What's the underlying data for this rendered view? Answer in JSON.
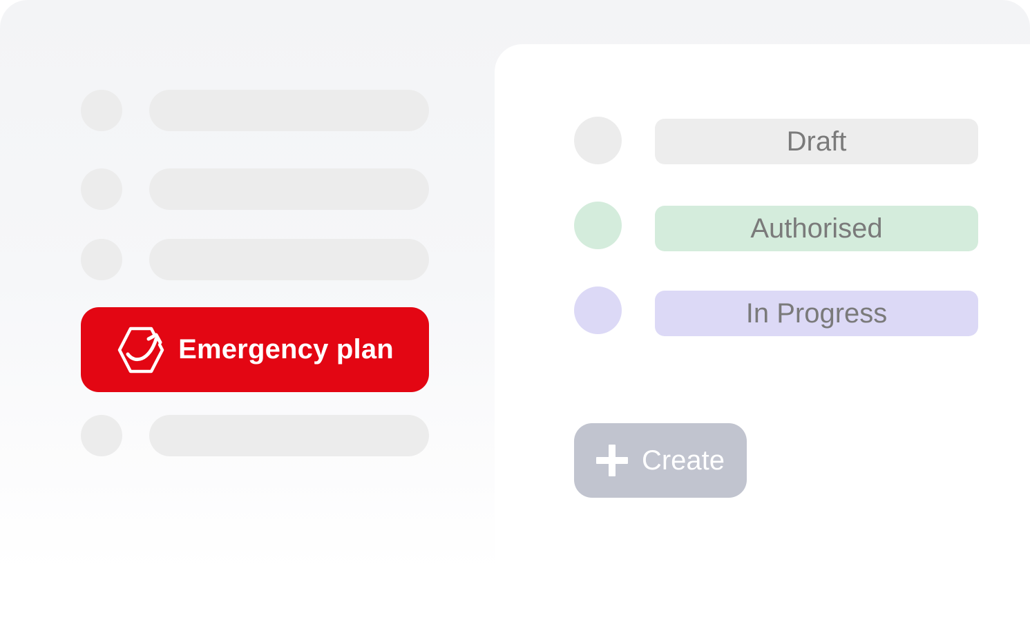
{
  "sidebar": {
    "emergency_button": {
      "label": "Emergency plan",
      "icon": "emergency-plan-icon",
      "color": "#e30613"
    },
    "placeholder_color": "#ececec"
  },
  "status_list": {
    "items": [
      {
        "label": "Draft",
        "dot_color": "#ececec",
        "pill_color": "#ededed"
      },
      {
        "label": "Authorised",
        "dot_color": "#d4ecdc",
        "pill_color": "#d4ecdc"
      },
      {
        "label": "In Progress",
        "dot_color": "#dcd9f6",
        "pill_color": "#dcd9f6"
      }
    ]
  },
  "create_button": {
    "label": "Create",
    "icon": "plus-icon",
    "color": "#c1c4cf"
  }
}
